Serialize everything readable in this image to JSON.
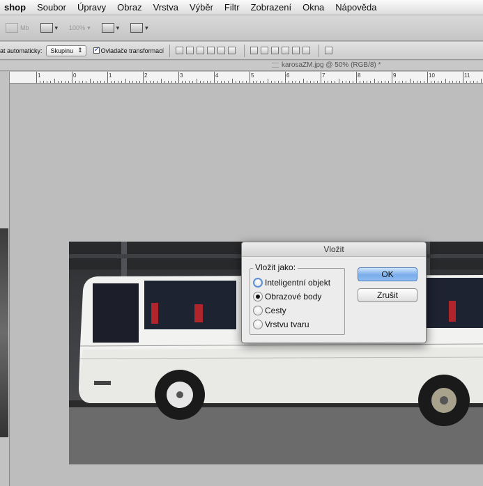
{
  "menubar": {
    "app_name": "shop",
    "items": [
      "Soubor",
      "Úpravy",
      "Obraz",
      "Vrstva",
      "Výběr",
      "Filtr",
      "Zobrazení",
      "Okna",
      "Nápověda"
    ]
  },
  "appbar": {
    "mini_label": "Mb",
    "zoom_label": "100%"
  },
  "options": {
    "auto_select_label": "at automaticky:",
    "auto_select_value": "Skupinu",
    "transform_controls_label": "Ovladače transformací"
  },
  "document": {
    "tab_title": "karosaZM.jpg @ 50% (RGB/8) *"
  },
  "ruler": {
    "labels": [
      "1",
      "0",
      "1",
      "2",
      "3",
      "4",
      "5",
      "6",
      "7",
      "8",
      "9",
      "10",
      "11"
    ]
  },
  "dialog": {
    "title": "Vložit",
    "group_label": "Vložit jako:",
    "options": [
      "Inteligentní objekt",
      "Obrazové body",
      "Cesty",
      "Vrstvu tvaru"
    ],
    "selected_option": "Obrazové body",
    "ok_label": "OK",
    "cancel_label": "Zrušit"
  },
  "colors": {
    "accent": "#79adeb",
    "canvas": "#bdbdbd"
  }
}
